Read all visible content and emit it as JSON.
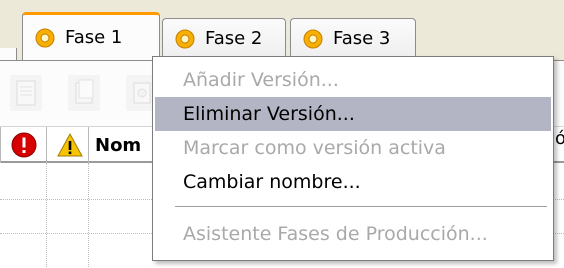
{
  "tabs": [
    {
      "label": "Fase 1",
      "icon": "gear-icon",
      "active": true
    },
    {
      "label": "Fase 2",
      "icon": "gear-icon",
      "active": false
    },
    {
      "label": "Fase 3",
      "icon": "gear-icon",
      "active": false
    }
  ],
  "toolbar": {
    "buttons": [
      {
        "icon": "document-icon",
        "enabled": false
      },
      {
        "icon": "copy-icon",
        "enabled": false
      },
      {
        "icon": "properties-icon",
        "enabled": false
      }
    ]
  },
  "grid": {
    "columns": [
      {
        "type": "icon",
        "icon": "error-icon"
      },
      {
        "type": "icon",
        "icon": "warning-icon"
      },
      {
        "type": "text",
        "label": "Nom"
      }
    ],
    "right_edge_char": "ó"
  },
  "context_menu": {
    "items": [
      {
        "label": "Añadir Versión...",
        "enabled": false,
        "highlighted": false
      },
      {
        "label": "Eliminar Versión...",
        "enabled": true,
        "highlighted": true
      },
      {
        "label": "Marcar como versión activa",
        "enabled": false,
        "highlighted": false
      },
      {
        "label": "Cambiar nombre...",
        "enabled": true,
        "highlighted": false
      },
      {
        "separator": true
      },
      {
        "label": "Asistente Fases de Producción...",
        "enabled": false,
        "highlighted": false
      }
    ]
  },
  "colors": {
    "accent_tab_border": "#ff9900",
    "menu_highlight": "#b4b5c4",
    "disabled_text": "#a9a9a9",
    "error_icon": "#d60000",
    "warning_icon": "#f6c400"
  }
}
